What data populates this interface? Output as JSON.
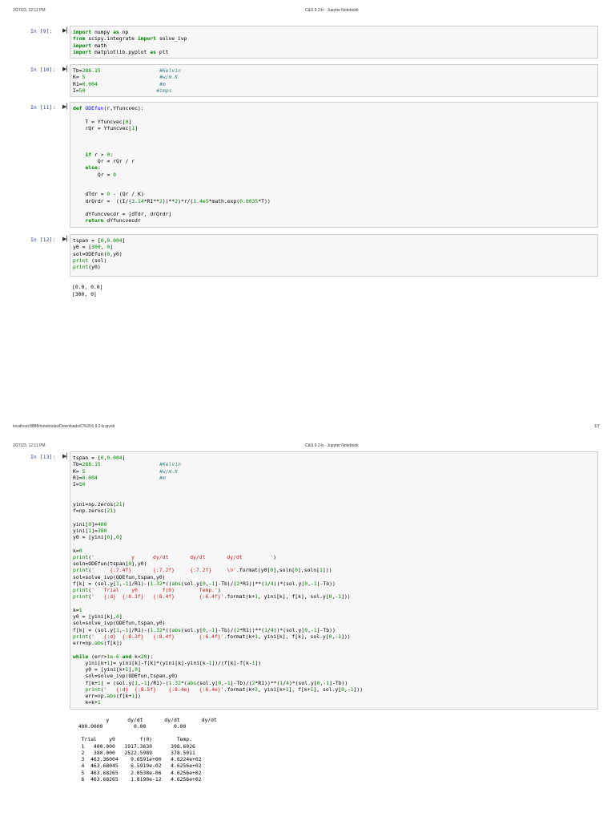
{
  "page1": {
    "date": "2/27/23, 12:11 PM",
    "title": "C&S 9.2-b - Jupyter Notebook",
    "footer_url": "localhost:8888/notebooks/Downloads/C%26S 9.2-b.ipynb",
    "footer_page": "1/7"
  },
  "page2": {
    "date": "2/27/23, 12:11 PM",
    "title": "C&S 9.2-b - Jupyter Notebook"
  },
  "run_icon": "run-cell-icon",
  "cells": [
    {
      "prompt": "In [9]:",
      "lines": [
        "import numpy as np",
        "from scipy.integrate import solve_ivp",
        "import math",
        "import matplotlib.pyplot as plt"
      ],
      "output": []
    },
    {
      "prompt": "In [10]:",
      "lines": [
        "Tb=288.15                   #Kelvin",
        "K= 5                        #w/m.K",
        "R1=0.004                    #m",
        "I=50                       #imps"
      ],
      "output": []
    },
    {
      "prompt": "In [11]:",
      "lines": [
        "def ODEfun(r,Yfuncvec):",
        "",
        "    T = Yfuncvec[0]",
        "    rQr = Yfuncvec[1]",
        "",
        "",
        "",
        "    if r > 0:",
        "        Qr = rQr / r",
        "    else:",
        "        Qr = 0",
        "",
        "",
        "    dTdr = 0 - (Qr / K)",
        "    drQrdr =  ((I/(3.14*R1**2))**2)*r/(1.4e5*math.exp(0.0035*T))",
        "",
        "    dYfuncvecdr = [dTdr, drQrdr]",
        "    return dYfuncvecdr"
      ],
      "output": []
    },
    {
      "prompt": "In [12]:",
      "lines": [
        "tspan = [0,0.004]",
        "y0 = [300, 0]",
        "sol=ODEfun(0,y0)",
        "print (sol)",
        "print(y0)"
      ],
      "output": [
        "[0.0, 0.0]",
        "[300, 0]"
      ]
    },
    {
      "prompt": "In [13]:",
      "lines": [
        "tspan = [0,0.004]",
        "Tb=288.15                   #Kelvin",
        "K= 5                        #w/m.K",
        "R1=0.004                    #m",
        "I=50",
        "",
        "",
        "yini=np.zeros(21)",
        "f=np.zeros(21)",
        "",
        "yini[0]=400",
        "yini[1]=380",
        "y0 = [yini[0],0]",
        "",
        "k=0",
        "print('            y      dy/dt       dy/dt       dy/dt         ')",
        "soln=ODEfun(tspan[0],y0)",
        "print('     {:7.4f}       {:7.2f}     {:7.2f}     \\n'.format(y0[0],soln[0],soln[1]))",
        "sol=solve_ivp(ODEfun,tspan,y0)",
        "f[k] = (sol.y[1,-1]/R1)-(1.32*((abs(sol.y[0,-1]-Tb)/(2*R1))**(1/4))*(sol.y[0,-1]-Tb))",
        "print('   Trial    y0        f(0)        Temp.')",
        "print('   {:d}  {:8.3f}   {:8.4f}        {:6.4f}'.format(k+1, yini[k], f[k], sol.y[0,-1]))",
        "",
        "k=1",
        "y0 = [yini[k],0]",
        "sol=solve_ivp(ODEfun,tspan,y0)",
        "f[k] = (sol.y[1,-1]/R1)-(1.32*((abs(sol.y[0,-1]-Tb)/(2*R1))**(1/4))*(sol.y[0,-1]-Tb))",
        "print('   {:d}  {:8.3f}   {:8.4f}        {:6.4f}'.format(k+1, yini[k], f[k], sol.y[0,-1]))",
        "err=np.abs(f[k])",
        "",
        "while (err>1e-6 and k<20):",
        "    yini[k+1]= yini[k]-f[k]*(yini[k]-yini[k-1])/(f[k]-f[k-1])",
        "    y0 = [yini[k+1],0]",
        "    sol=solve_ivp(ODEfun,tspan,y0)",
        "    f[k+1] = (sol.y[1,-1]/R1)-(1.32*(abs(sol.y[0,-1]-Tb)/(2*R1))**(1/4)*(sol.y[0,-1]-Tb))",
        "    print('   {:d}  {:8.5f}    {:8.4e}   {:6.4e}'.format(k+2, yini[k+1], f[k+1], sol.y[0,-1]))",
        "    err=np.abs(f[k+1])",
        "    k=k+1"
      ],
      "output": [
        "           y      dy/dt       dy/dt       dy/dt",
        "  400.0000          0.00         0.00",
        "",
        "   Trial    y0        f(0)        Temp.",
        "   1   400.000   1917.3630      398.6026",
        "   2   380.000   2522.5989      378.5011",
        "   3  463.36004    9.6591e+00   4.6224e+02",
        "   4  463.68045    6.5919e-02   4.6256e+02",
        "   5  463.68265    2.0538e-06   4.6256e+02",
        "   6  463.68265    1.8190e-12   4.6256e+02"
      ]
    }
  ]
}
